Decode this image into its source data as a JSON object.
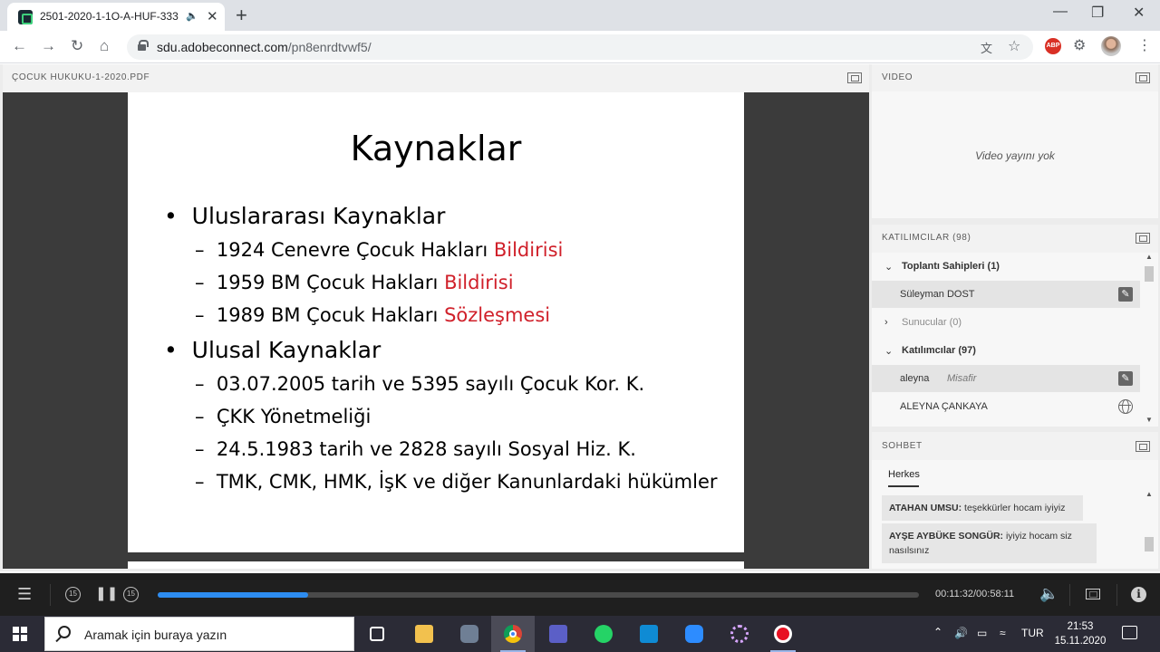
{
  "browser": {
    "tab_title": "2501-2020-1-1O-A-HUF-333",
    "url_host": "sdu.adobeconnect.com",
    "url_path": "/pn8enrdtvwf5/"
  },
  "share_pod": {
    "title": "ÇOCUK HUKUKU-1-2020.PDF",
    "slide": {
      "title": "Kaynaklar",
      "sections": [
        {
          "heading": "Uluslararası Kaynaklar",
          "items": [
            {
              "text": "1924 Cenevre Çocuk Hakları ",
              "highlight": "Bildirisi"
            },
            {
              "text": "1959 BM Çocuk Hakları ",
              "highlight": "Bildirisi"
            },
            {
              "text": "1989 BM Çocuk Hakları ",
              "highlight": "Sözleşmesi"
            }
          ]
        },
        {
          "heading": "Ulusal Kaynaklar",
          "items": [
            {
              "text": "03.07.2005 tarih ve 5395 sayılı Çocuk Kor. K."
            },
            {
              "text": "ÇKK Yönetmeliği"
            },
            {
              "text": "24.5.1983 tarih ve 2828 sayılı Sosyal Hiz. K."
            },
            {
              "text": "TMK, CMK, HMK, İşK ve diğer Kanunlardaki hükümler"
            }
          ]
        }
      ]
    }
  },
  "video_pod": {
    "title": "VIDEO",
    "empty_message": "Video yayını yok"
  },
  "attendees_pod": {
    "title": "KATILIMCILAR  (98)",
    "groups": [
      {
        "label": "Toplantı Sahipleri (1)",
        "expanded": true
      },
      {
        "label": "Sunucular (0)",
        "expanded": false
      },
      {
        "label": "Katılımcılar (97)",
        "expanded": true
      }
    ],
    "people": [
      {
        "name": "Süleyman DOST",
        "tag": "",
        "icon": "wrench-icon"
      },
      {
        "name": "aleyna",
        "tag": "Misafir",
        "icon": "wrench-icon"
      },
      {
        "name": "ALEYNA ÇANKAYA",
        "tag": "",
        "icon": "globe-icon"
      }
    ]
  },
  "chat_pod": {
    "title": "SOHBET",
    "tab": "Herkes",
    "messages": [
      {
        "sender": "ATAHAN UMSU:",
        "text": " teşekkürler hocam iyiyiz"
      },
      {
        "sender": "AYŞE AYBÜKE SONGÜR:",
        "text": " iyiyiz hocam siz nasılsınız"
      }
    ]
  },
  "playback": {
    "skip_back_label": "15",
    "skip_fwd_label": "15",
    "timecode": "00:11:32/00:58:11",
    "progress": 0.198,
    "accent": "#2d8cf0"
  },
  "taskbar": {
    "search_placeholder": "Aramak için buraya yazın",
    "language": "TUR",
    "time": "21:53",
    "date": "15.11.2020"
  }
}
